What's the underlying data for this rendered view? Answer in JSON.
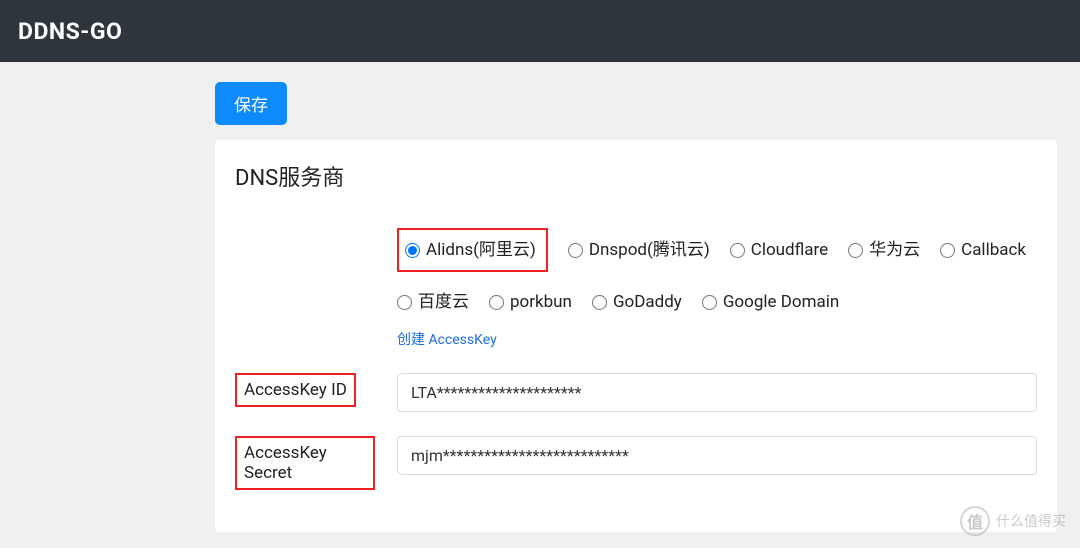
{
  "header": {
    "title": "DDNS-GO"
  },
  "actions": {
    "save_label": "保存"
  },
  "card": {
    "title": "DNS服务商",
    "providers": [
      {
        "label": "Alidns(阿里云)",
        "checked": true,
        "highlighted": true
      },
      {
        "label": "Dnspod(腾讯云)",
        "checked": false,
        "highlighted": false
      },
      {
        "label": "Cloudflare",
        "checked": false,
        "highlighted": false
      },
      {
        "label": "华为云",
        "checked": false,
        "highlighted": false
      },
      {
        "label": "Callback",
        "checked": false,
        "highlighted": false
      },
      {
        "label": "百度云",
        "checked": false,
        "highlighted": false
      },
      {
        "label": "porkbun",
        "checked": false,
        "highlighted": false
      },
      {
        "label": "GoDaddy",
        "checked": false,
        "highlighted": false
      },
      {
        "label": "Google Domain",
        "checked": false,
        "highlighted": false
      }
    ],
    "create_key_link": "创建 AccessKey",
    "fields": {
      "access_key_id": {
        "label": "AccessKey ID",
        "value": "LTA*********************"
      },
      "access_key_secret": {
        "label": "AccessKey Secret",
        "value": "mjm***************************"
      }
    }
  },
  "watermark": {
    "icon_text": "值",
    "text": "什么值得买"
  }
}
